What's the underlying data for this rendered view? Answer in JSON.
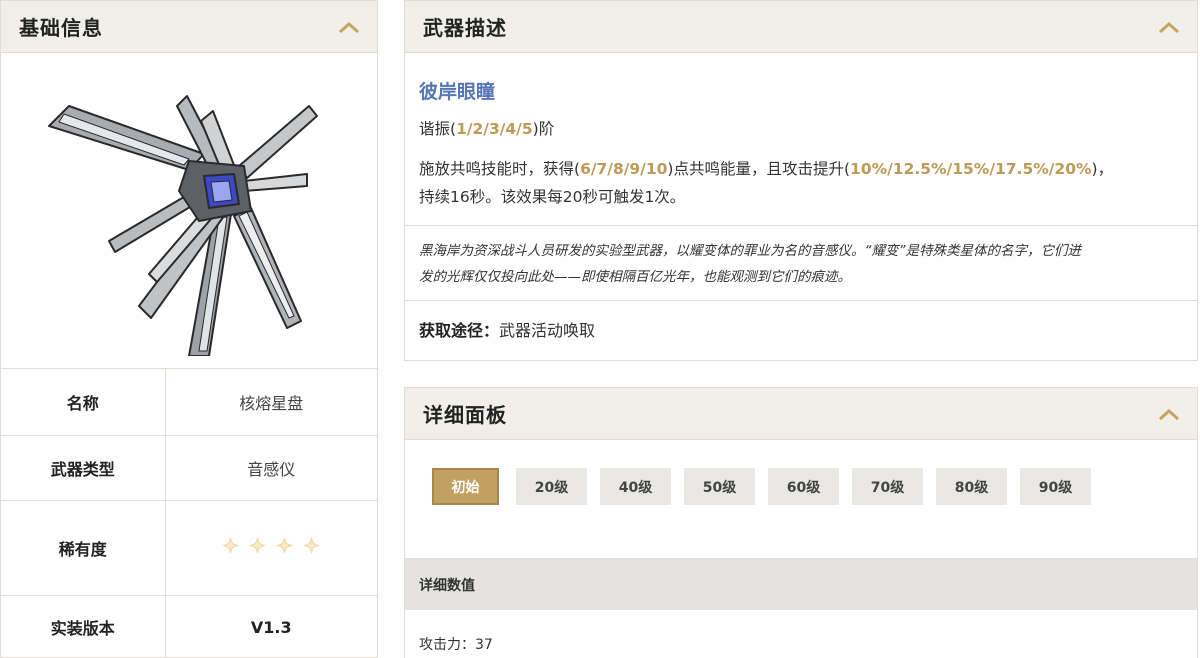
{
  "basic_info": {
    "title": "基础信息",
    "rows": [
      {
        "label": "名称",
        "value": "核熔星盘"
      },
      {
        "label": "武器类型",
        "value": "音感仪"
      },
      {
        "label": "稀有度",
        "stars": 4
      },
      {
        "label": "实装版本",
        "value": "V1.3"
      }
    ]
  },
  "description": {
    "title": "武器描述",
    "weapon_name": "彼岸眼瞳",
    "resonance_prefix": "谐振(",
    "resonance_values": "1/2/3/4/5",
    "resonance_suffix": ")阶",
    "effect_part1": "施放共鸣技能时，获得(",
    "effect_energy": "6/7/8/9/10",
    "effect_part2": ")点共鸣能量，且攻击提升(",
    "effect_atk": "10%/12.5%/15%/17.5%/20%",
    "effect_part3": ")，",
    "effect_line2": "持续16秒。该效果每20秒可触发1次。",
    "lore_line1": "黑海岸为资深战斗人员研发的实验型武器，以耀变体的罪业为名的音感仪。“耀变”是特殊类星体的名字，它们迸",
    "lore_line2": "发的光辉仅仅投向此处——即使相隔百亿光年，也能观测到它们的痕迹。",
    "acquire_label": "获取途径：",
    "acquire_value": "武器活动唤取"
  },
  "detail": {
    "title": "详细面板",
    "levels": [
      "初始",
      "20级",
      "40级",
      "50级",
      "60级",
      "70级",
      "80级",
      "90级"
    ],
    "active_level": "初始",
    "section_label": "详细数值",
    "stat_label": "攻击力：",
    "stat_value": "37"
  },
  "colors": {
    "accent_gold": "#c1a060",
    "weapon_name_blue": "#5676b8",
    "highlight_gold": "#bd9a55",
    "star_color": "#f3d9a6"
  },
  "icons": {
    "collapse": "chevron-up-icon",
    "rarity": "diamond-star-icon",
    "weapon": "weapon-image"
  }
}
